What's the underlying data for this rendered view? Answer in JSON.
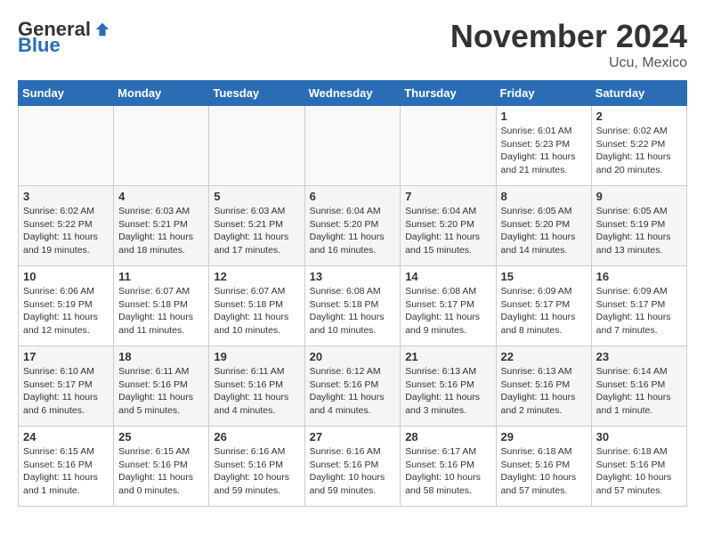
{
  "logo": {
    "general": "General",
    "blue": "Blue"
  },
  "title": "November 2024",
  "location": "Ucu, Mexico",
  "headers": [
    "Sunday",
    "Monday",
    "Tuesday",
    "Wednesday",
    "Thursday",
    "Friday",
    "Saturday"
  ],
  "weeks": [
    [
      {
        "day": "",
        "info": ""
      },
      {
        "day": "",
        "info": ""
      },
      {
        "day": "",
        "info": ""
      },
      {
        "day": "",
        "info": ""
      },
      {
        "day": "",
        "info": ""
      },
      {
        "day": "1",
        "info": "Sunrise: 6:01 AM\nSunset: 5:23 PM\nDaylight: 11 hours and 21 minutes."
      },
      {
        "day": "2",
        "info": "Sunrise: 6:02 AM\nSunset: 5:22 PM\nDaylight: 11 hours and 20 minutes."
      }
    ],
    [
      {
        "day": "3",
        "info": "Sunrise: 6:02 AM\nSunset: 5:22 PM\nDaylight: 11 hours and 19 minutes."
      },
      {
        "day": "4",
        "info": "Sunrise: 6:03 AM\nSunset: 5:21 PM\nDaylight: 11 hours and 18 minutes."
      },
      {
        "day": "5",
        "info": "Sunrise: 6:03 AM\nSunset: 5:21 PM\nDaylight: 11 hours and 17 minutes."
      },
      {
        "day": "6",
        "info": "Sunrise: 6:04 AM\nSunset: 5:20 PM\nDaylight: 11 hours and 16 minutes."
      },
      {
        "day": "7",
        "info": "Sunrise: 6:04 AM\nSunset: 5:20 PM\nDaylight: 11 hours and 15 minutes."
      },
      {
        "day": "8",
        "info": "Sunrise: 6:05 AM\nSunset: 5:20 PM\nDaylight: 11 hours and 14 minutes."
      },
      {
        "day": "9",
        "info": "Sunrise: 6:05 AM\nSunset: 5:19 PM\nDaylight: 11 hours and 13 minutes."
      }
    ],
    [
      {
        "day": "10",
        "info": "Sunrise: 6:06 AM\nSunset: 5:19 PM\nDaylight: 11 hours and 12 minutes."
      },
      {
        "day": "11",
        "info": "Sunrise: 6:07 AM\nSunset: 5:18 PM\nDaylight: 11 hours and 11 minutes."
      },
      {
        "day": "12",
        "info": "Sunrise: 6:07 AM\nSunset: 5:18 PM\nDaylight: 11 hours and 10 minutes."
      },
      {
        "day": "13",
        "info": "Sunrise: 6:08 AM\nSunset: 5:18 PM\nDaylight: 11 hours and 10 minutes."
      },
      {
        "day": "14",
        "info": "Sunrise: 6:08 AM\nSunset: 5:17 PM\nDaylight: 11 hours and 9 minutes."
      },
      {
        "day": "15",
        "info": "Sunrise: 6:09 AM\nSunset: 5:17 PM\nDaylight: 11 hours and 8 minutes."
      },
      {
        "day": "16",
        "info": "Sunrise: 6:09 AM\nSunset: 5:17 PM\nDaylight: 11 hours and 7 minutes."
      }
    ],
    [
      {
        "day": "17",
        "info": "Sunrise: 6:10 AM\nSunset: 5:17 PM\nDaylight: 11 hours and 6 minutes."
      },
      {
        "day": "18",
        "info": "Sunrise: 6:11 AM\nSunset: 5:16 PM\nDaylight: 11 hours and 5 minutes."
      },
      {
        "day": "19",
        "info": "Sunrise: 6:11 AM\nSunset: 5:16 PM\nDaylight: 11 hours and 4 minutes."
      },
      {
        "day": "20",
        "info": "Sunrise: 6:12 AM\nSunset: 5:16 PM\nDaylight: 11 hours and 4 minutes."
      },
      {
        "day": "21",
        "info": "Sunrise: 6:13 AM\nSunset: 5:16 PM\nDaylight: 11 hours and 3 minutes."
      },
      {
        "day": "22",
        "info": "Sunrise: 6:13 AM\nSunset: 5:16 PM\nDaylight: 11 hours and 2 minutes."
      },
      {
        "day": "23",
        "info": "Sunrise: 6:14 AM\nSunset: 5:16 PM\nDaylight: 11 hours and 1 minute."
      }
    ],
    [
      {
        "day": "24",
        "info": "Sunrise: 6:15 AM\nSunset: 5:16 PM\nDaylight: 11 hours and 1 minute."
      },
      {
        "day": "25",
        "info": "Sunrise: 6:15 AM\nSunset: 5:16 PM\nDaylight: 11 hours and 0 minutes."
      },
      {
        "day": "26",
        "info": "Sunrise: 6:16 AM\nSunset: 5:16 PM\nDaylight: 10 hours and 59 minutes."
      },
      {
        "day": "27",
        "info": "Sunrise: 6:16 AM\nSunset: 5:16 PM\nDaylight: 10 hours and 59 minutes."
      },
      {
        "day": "28",
        "info": "Sunrise: 6:17 AM\nSunset: 5:16 PM\nDaylight: 10 hours and 58 minutes."
      },
      {
        "day": "29",
        "info": "Sunrise: 6:18 AM\nSunset: 5:16 PM\nDaylight: 10 hours and 57 minutes."
      },
      {
        "day": "30",
        "info": "Sunrise: 6:18 AM\nSunset: 5:16 PM\nDaylight: 10 hours and 57 minutes."
      }
    ]
  ]
}
